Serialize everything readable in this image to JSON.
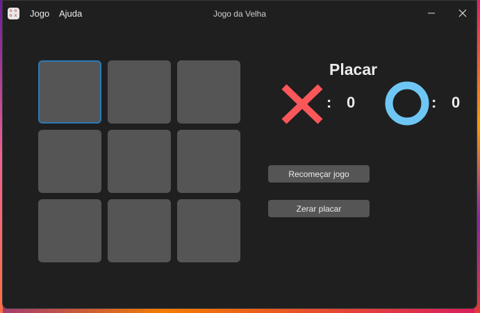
{
  "window": {
    "title": "Jogo da Velha"
  },
  "menu": {
    "items": [
      {
        "label": "Jogo"
      },
      {
        "label": "Ajuda"
      }
    ]
  },
  "board": {
    "cells": [
      "",
      "",
      "",
      "",
      "",
      "",
      "",
      "",
      ""
    ],
    "focused_cell": 0
  },
  "score": {
    "title": "Placar",
    "x": {
      "icon": "x-mark-icon",
      "separator": ":",
      "value": "0",
      "color": "#f9575a"
    },
    "o": {
      "icon": "o-ring-icon",
      "separator": ":",
      "value": "0",
      "color": "#6ec6f5"
    }
  },
  "actions": {
    "restart_label": "Recomeçar jogo",
    "reset_score_label": "Zerar placar"
  },
  "colors": {
    "window_bg": "#1f1f1f",
    "cell_bg": "#555555",
    "focus_border": "#2a7ab8"
  }
}
